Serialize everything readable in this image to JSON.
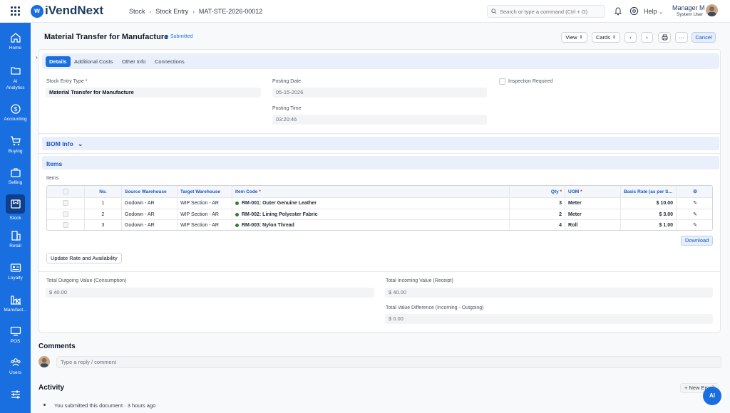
{
  "app": {
    "name": "iVendNext"
  },
  "breadcrumbs": [
    "Stock",
    "Stock Entry",
    "MAT-STE-2026-00012"
  ],
  "search": {
    "placeholder": "Search or type a command (Ctrl + G)"
  },
  "header": {
    "help": "Help",
    "user_name": "Manager M",
    "user_role": "System User"
  },
  "sidebar": {
    "items": [
      {
        "label": "Home",
        "icon": "home-icon"
      },
      {
        "label": "AI Analytics",
        "icon": "folder-icon"
      },
      {
        "label": "Accounting",
        "icon": "dollar-icon"
      },
      {
        "label": "Buying",
        "icon": "cart-icon"
      },
      {
        "label": "Selling",
        "icon": "briefcase-icon"
      },
      {
        "label": "Stock",
        "icon": "box-icon"
      },
      {
        "label": "Retail",
        "icon": "store-icon"
      },
      {
        "label": "Loyalty",
        "icon": "card-icon"
      },
      {
        "label": "Manufact...",
        "icon": "factory-icon"
      },
      {
        "label": "POS",
        "icon": "monitor-icon"
      },
      {
        "label": "Users",
        "icon": "users-icon"
      },
      {
        "label": "",
        "icon": "sliders-icon"
      }
    ]
  },
  "page": {
    "title": "Material Transfer for Manufacture",
    "status": "Submitted",
    "buttons": {
      "view": "View",
      "cards": "Cards",
      "cancel": "Cancel"
    }
  },
  "tabs": [
    "Details",
    "Additional Costs",
    "Other Info",
    "Connections"
  ],
  "details": {
    "entry_type_label": "Stock Entry Type",
    "entry_type_value": "Material Transfer for Manufacture",
    "posting_date_label": "Posting Date",
    "posting_date_value": "05-15-2026",
    "posting_time_label": "Posting Time",
    "posting_time_value": "03:20:46",
    "inspection_label": "Inspection Required"
  },
  "bom_info": {
    "title": "BOM Info"
  },
  "items_section": {
    "title": "Items",
    "table_label": "Items",
    "columns": {
      "no": "No.",
      "source": "Source Warehouse",
      "target": "Target Warehouse",
      "item_code": "Item Code",
      "qty": "Qty",
      "uom": "UOM",
      "rate": "Basic Rate (as per S..."
    },
    "rows": [
      {
        "no": "1",
        "source": "Godown - AR",
        "target": "WIP Section - AR",
        "item": "RM-001: Outer Genuine Leather",
        "qty": "3",
        "uom": "Meter",
        "rate": "$ 10.00"
      },
      {
        "no": "2",
        "source": "Godown - AR",
        "target": "WIP Section - AR",
        "item": "RM-002: Lining Polyester Fabric",
        "qty": "2",
        "uom": "Meter",
        "rate": "$ 3.00"
      },
      {
        "no": "3",
        "source": "Godown - AR",
        "target": "WIP Section - AR",
        "item": "RM-003: Nylon Thread",
        "qty": "4",
        "uom": "Roll",
        "rate": "$ 1.00"
      }
    ],
    "download": "Download",
    "update_button": "Update Rate and Availability"
  },
  "totals": {
    "outgoing_label": "Total Outgoing Value (Consumption)",
    "outgoing_value": "$ 40.00",
    "incoming_label": "Total Incoming Value (Receipt)",
    "incoming_value": "$ 40.00",
    "difference_label": "Total Value Difference (Incoming - Outgoing)",
    "difference_value": "$ 0.00"
  },
  "comments": {
    "title": "Comments",
    "placeholder": "Type a reply / comment"
  },
  "activity": {
    "title": "Activity",
    "new_email": "+ New Email",
    "entry": "You submitted this document · 3 hours ago"
  },
  "fab": {
    "label": "AI"
  },
  "colors": {
    "primary": "#1a6fe0",
    "sidebar": "#1a6fe0",
    "active_dot": "#2e7d32"
  }
}
